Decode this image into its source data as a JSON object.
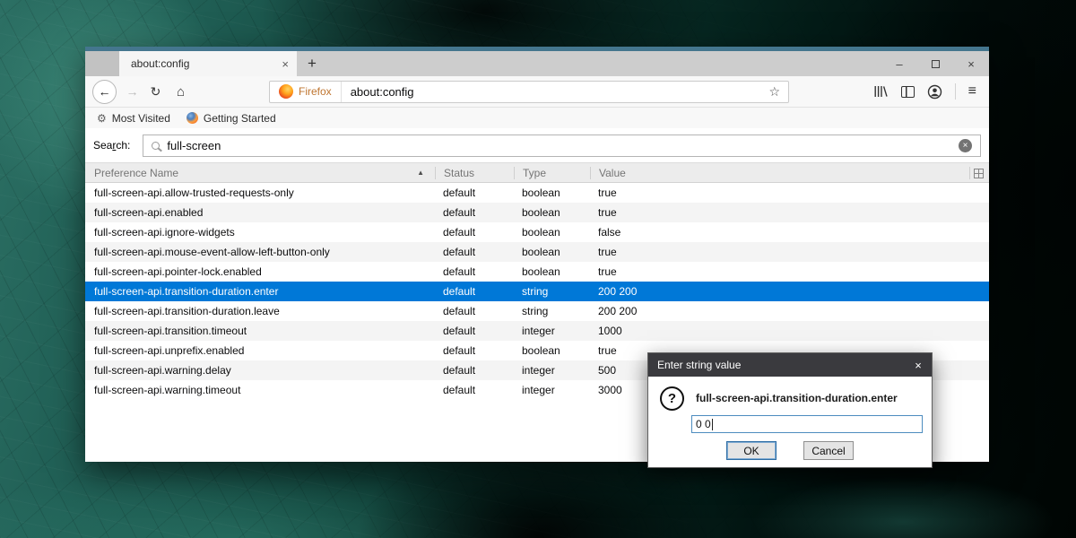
{
  "colors": {
    "accent": "#0078d7",
    "selected_row_bg": "#0078d7",
    "window_accent_border": "#44768e",
    "dialog_titlebar": "#3a3a3e"
  },
  "icons": {
    "back": "←",
    "forward": "→",
    "reload": "↻",
    "home": "⌂",
    "bookmark_star": "☆",
    "menu": "≡",
    "tab_close": "×",
    "new_tab": "+",
    "window_minimize": "–",
    "window_close": "×",
    "sort_ascending": "▲",
    "gear": "⚙",
    "search_clear": "×",
    "dialog_close": "×",
    "question": "?"
  },
  "window": {
    "tab_title": "about:config",
    "url_badge": "Firefox",
    "url": "about:config",
    "bookmarks": {
      "most_visited": "Most Visited",
      "getting_started": "Getting Started"
    }
  },
  "search": {
    "label_pre": "Sea",
    "label_key": "r",
    "label_post": "ch:",
    "value": "full-screen"
  },
  "table": {
    "headers": {
      "name": "Preference Name",
      "status": "Status",
      "type": "Type",
      "value": "Value"
    },
    "rows": [
      {
        "name": "full-screen-api.allow-trusted-requests-only",
        "status": "default",
        "type": "boolean",
        "value": "true"
      },
      {
        "name": "full-screen-api.enabled",
        "status": "default",
        "type": "boolean",
        "value": "true"
      },
      {
        "name": "full-screen-api.ignore-widgets",
        "status": "default",
        "type": "boolean",
        "value": "false"
      },
      {
        "name": "full-screen-api.mouse-event-allow-left-button-only",
        "status": "default",
        "type": "boolean",
        "value": "true"
      },
      {
        "name": "full-screen-api.pointer-lock.enabled",
        "status": "default",
        "type": "boolean",
        "value": "true"
      },
      {
        "name": "full-screen-api.transition-duration.enter",
        "status": "default",
        "type": "string",
        "value": "200 200",
        "selected": true
      },
      {
        "name": "full-screen-api.transition-duration.leave",
        "status": "default",
        "type": "string",
        "value": "200 200"
      },
      {
        "name": "full-screen-api.transition.timeout",
        "status": "default",
        "type": "integer",
        "value": "1000"
      },
      {
        "name": "full-screen-api.unprefix.enabled",
        "status": "default",
        "type": "boolean",
        "value": "true"
      },
      {
        "name": "full-screen-api.warning.delay",
        "status": "default",
        "type": "integer",
        "value": "500"
      },
      {
        "name": "full-screen-api.warning.timeout",
        "status": "default",
        "type": "integer",
        "value": "3000"
      }
    ]
  },
  "dialog": {
    "title": "Enter string value",
    "pref_name": "full-screen-api.transition-duration.enter",
    "input_value": "0 0",
    "ok_label": "OK",
    "cancel_label": "Cancel"
  }
}
